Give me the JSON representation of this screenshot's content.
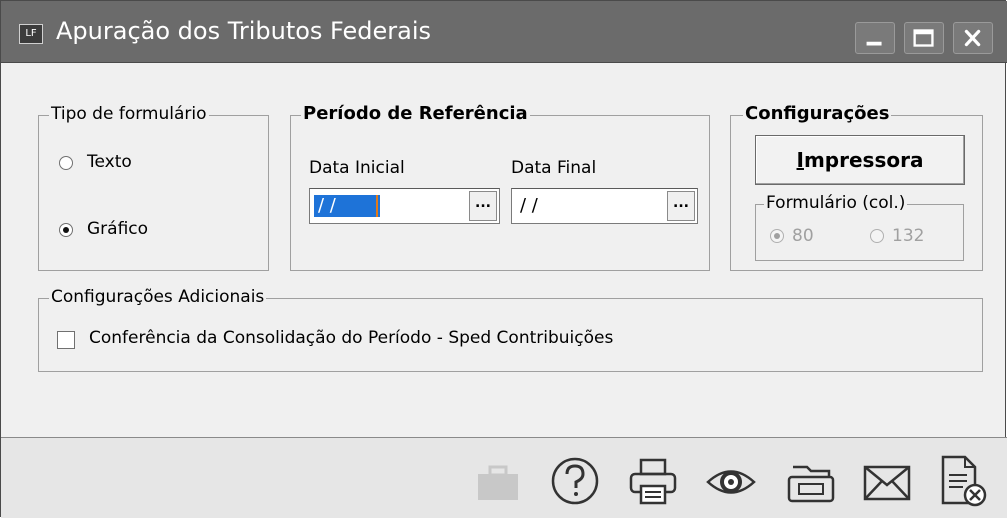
{
  "window": {
    "app_icon_text": "LF",
    "title": "Apuração dos Tributos Federais",
    "controls": [
      "minimize-icon",
      "maximize-icon",
      "close-icon"
    ]
  },
  "tipo_formulario": {
    "legend": "Tipo de formulário",
    "options": [
      {
        "label": "Texto",
        "checked": false
      },
      {
        "label": "Gráfico",
        "checked": true
      }
    ]
  },
  "periodo": {
    "legend": "Período de Referência",
    "data_inicial_label": "Data Inicial",
    "data_inicial_value": "/ /",
    "data_final_label": "Data Final",
    "data_final_value": "/ /",
    "lookup_button_label": "..."
  },
  "configuracoes": {
    "legend": "Configurações",
    "impressora_label_underlined": "I",
    "impressora_label_rest": "mpressora",
    "formulario_legend": "Formulário (col.)",
    "options": [
      {
        "label": "80",
        "checked": true
      },
      {
        "label": "132",
        "checked": false
      }
    ]
  },
  "adicionais": {
    "legend": "Configurações Adicionais",
    "checkbox_label": "Conferência da Consolidação do Período - Sped Contribuições",
    "checked": false
  },
  "toolbar": {
    "icons": [
      "briefcase-icon",
      "help-icon",
      "printer-icon",
      "preview-eye-icon",
      "open-folder-icon",
      "email-icon",
      "close-document-icon"
    ]
  },
  "colors": {
    "titlebar": "#6b6b6b",
    "selection": "#1e73d8",
    "caret": "#e07a1a"
  }
}
